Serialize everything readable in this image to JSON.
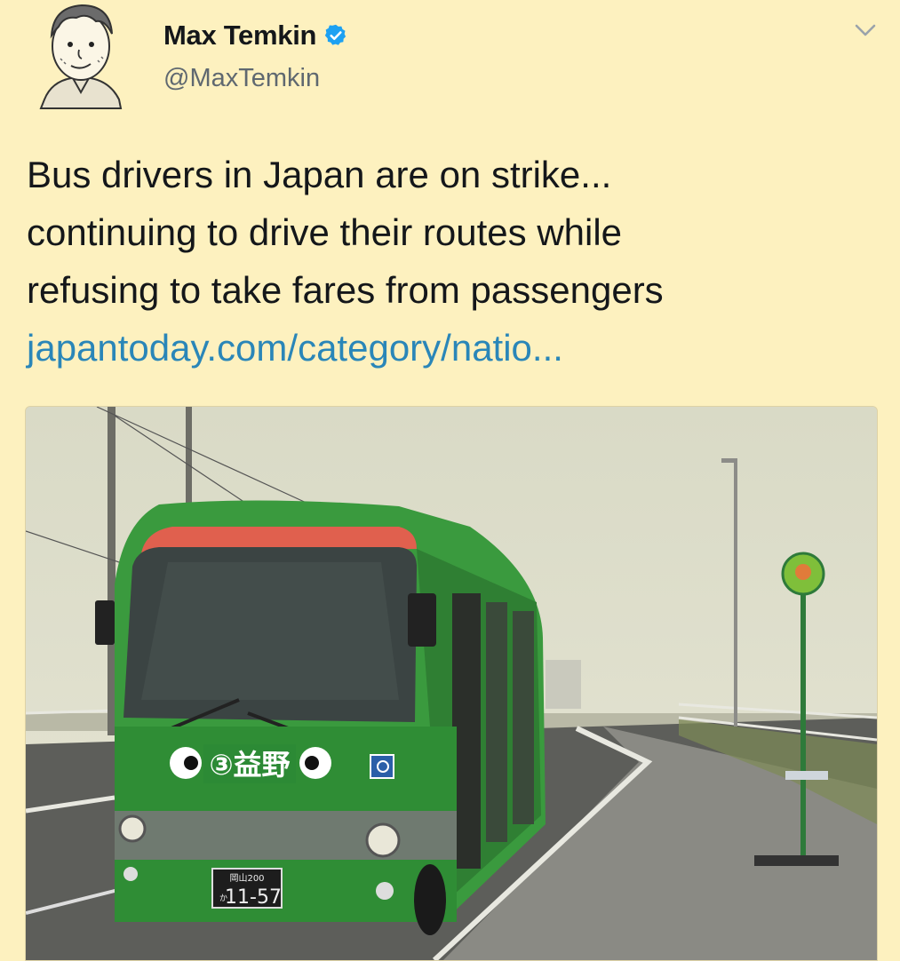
{
  "tweet": {
    "author_name": "Max Temkin",
    "handle": "@MaxTemkin",
    "verified": true,
    "text_lines": [
      "Bus drivers in Japan are on strike...",
      "continuing to drive their routes while",
      "refusing to take fares from passengers"
    ],
    "link_text": "japantoday.com/category/natio..."
  },
  "photo": {
    "bus_route_sign": "③益野",
    "plate_region": "岡山200",
    "plate_kana": "か",
    "plate_number": "11-57",
    "bus_color": "#3a9a3e"
  },
  "icons": {
    "verified": "verified-badge-icon",
    "more": "chevron-down-icon"
  },
  "colors": {
    "background": "#fdf1bf",
    "link": "#2a86b8",
    "verified": "#1da1f2"
  }
}
